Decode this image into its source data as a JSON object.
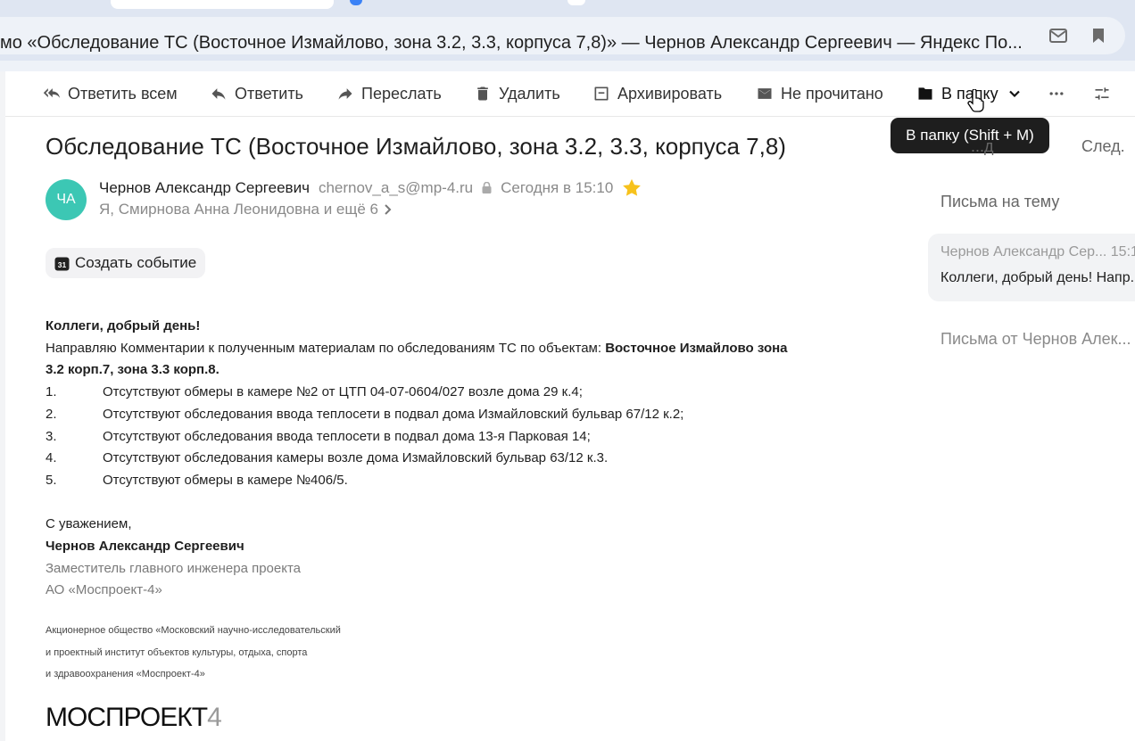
{
  "browser": {
    "window_title": "мо «Обследование ТС (Восточное Измайлово, зона 3.2, 3.3, корпуса 7,8)» — Чернов Александр Сергеевич — Яндекс По..."
  },
  "toolbar": {
    "reply_all": "Ответить всем",
    "reply": "Ответить",
    "forward": "Переслать",
    "delete": "Удалить",
    "archive": "Архивировать",
    "mark_unread": "Не прочитано",
    "to_folder": "В папку",
    "tooltip": "В папку (Shift + M)"
  },
  "message": {
    "subject": "Обследование ТС (Восточное Измайлово, зона 3.2, 3.3, корпуса 7,8)",
    "avatar_initials": "ЧА",
    "sender_name": "Чернов Александр Сергеевич",
    "sender_email": "chernov_a_s@mp-4.ru",
    "date": "Сегодня в 15:10",
    "recipients": "Я, Смирнова Анна Леонидовна и ещё 6",
    "create_event": "Создать событие",
    "greeting": "Коллеги, добрый день!",
    "intro": "Направляю Комментарии к полученным материалам по обследованиям ТС по объектам: ",
    "intro_bold_1": "Восточное Измайлово зона",
    "intro_bold_2": "3.2 корп.7, зона 3.3 корп.8.",
    "items": [
      {
        "num": "1.",
        "text": "Отсутствуют обмеры в камере №2 от ЦТП 04-07-0604/027 возле дома 29 к.4;"
      },
      {
        "num": "2.",
        "text": "Отсутствуют обследования ввода теплосети в подвал дома Измайловский бульвар 67/12 к.2;"
      },
      {
        "num": "3.",
        "text": "Отсутствуют обследования ввода теплосети в подвал дома 13-я Парковая 14;"
      },
      {
        "num": "4.",
        "text": "Отсутствуют обследования камеры возле дома Измайловский бульвар 63/12 к.3."
      },
      {
        "num": "5.",
        "text": "Отсутствуют обмеры в камере №406/5."
      }
    ],
    "regards": "С уважением,",
    "signature_name": "Чернов Александр Сергеевич",
    "signature_title": "Заместитель главного инженера проекта",
    "signature_company": "АО «Моспроект-4»",
    "footer_line1": "Акционерное общество «Московский научно-исследовательский",
    "footer_line2": "и проектный институт объектов культуры, отдыха, спорта",
    "footer_line3": "и здравоохранения «Моспроект-4»",
    "logo_text": "МОСПРОЕКТ",
    "logo_num": "4"
  },
  "right_pane": {
    "peek_text": "...д",
    "next": "След.",
    "thread_title": "Письма на тему",
    "card_from": "Чернов Александр Сер...  15:1",
    "card_snippet": "Коллеги, добрый день! Напр...",
    "from_link": "Письма от Чернов Алек..."
  },
  "colors": {
    "avatar": "#3cc7b4",
    "star": "#f7c21c",
    "tooltip_bg": "#1e1e1e"
  }
}
